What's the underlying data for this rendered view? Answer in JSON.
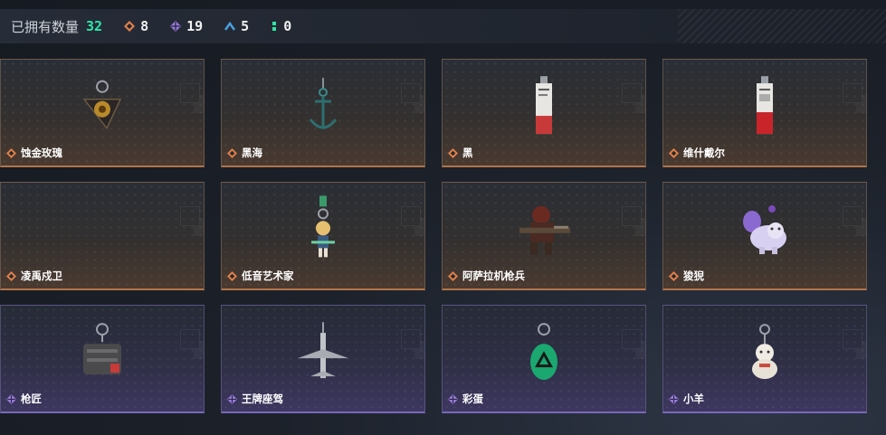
{
  "header": {
    "owned_label": "已拥有数量",
    "owned_count": "32",
    "stats": [
      {
        "icon": "orange-diamond-icon",
        "value": "8",
        "color": "#e0804a"
      },
      {
        "icon": "purple-diamond-icon",
        "value": "19",
        "color": "#9a7ae0"
      },
      {
        "icon": "blue-chevron-icon",
        "value": "5",
        "color": "#4aa0e0"
      },
      {
        "icon": "green-dots-icon",
        "value": "0",
        "color": "#2ee6a8"
      }
    ]
  },
  "colors": {
    "orange_rarity": "#e0804a",
    "purple_rarity": "#9a7ae0",
    "accent_green": "#2ee6a8"
  },
  "items": [
    {
      "name": "蚀金玫瑰",
      "rarity": "orange",
      "icon": "rose-emblem-charm"
    },
    {
      "name": "黑海",
      "rarity": "orange",
      "icon": "anchor-charm"
    },
    {
      "name": "黑",
      "rarity": "orange",
      "icon": "card-tag-charm"
    },
    {
      "name": "维什戴尔",
      "rarity": "orange",
      "icon": "card-tag-red-charm"
    },
    {
      "name": "凌禹戍卫",
      "rarity": "orange",
      "icon": "empty"
    },
    {
      "name": "低音艺术家",
      "rarity": "orange",
      "icon": "chibi-figure-charm"
    },
    {
      "name": "阿萨拉机枪兵",
      "rarity": "orange",
      "icon": "gunner-figure-charm"
    },
    {
      "name": "狻猊",
      "rarity": "orange",
      "icon": "lion-plush-charm"
    },
    {
      "name": "枪匠",
      "rarity": "purple",
      "icon": "bag-charm"
    },
    {
      "name": "王牌座驾",
      "rarity": "purple",
      "icon": "jet-charm"
    },
    {
      "name": "彩蛋",
      "rarity": "purple",
      "icon": "green-egg-charm"
    },
    {
      "name": "小羊",
      "rarity": "purple",
      "icon": "lamb-charm"
    }
  ]
}
